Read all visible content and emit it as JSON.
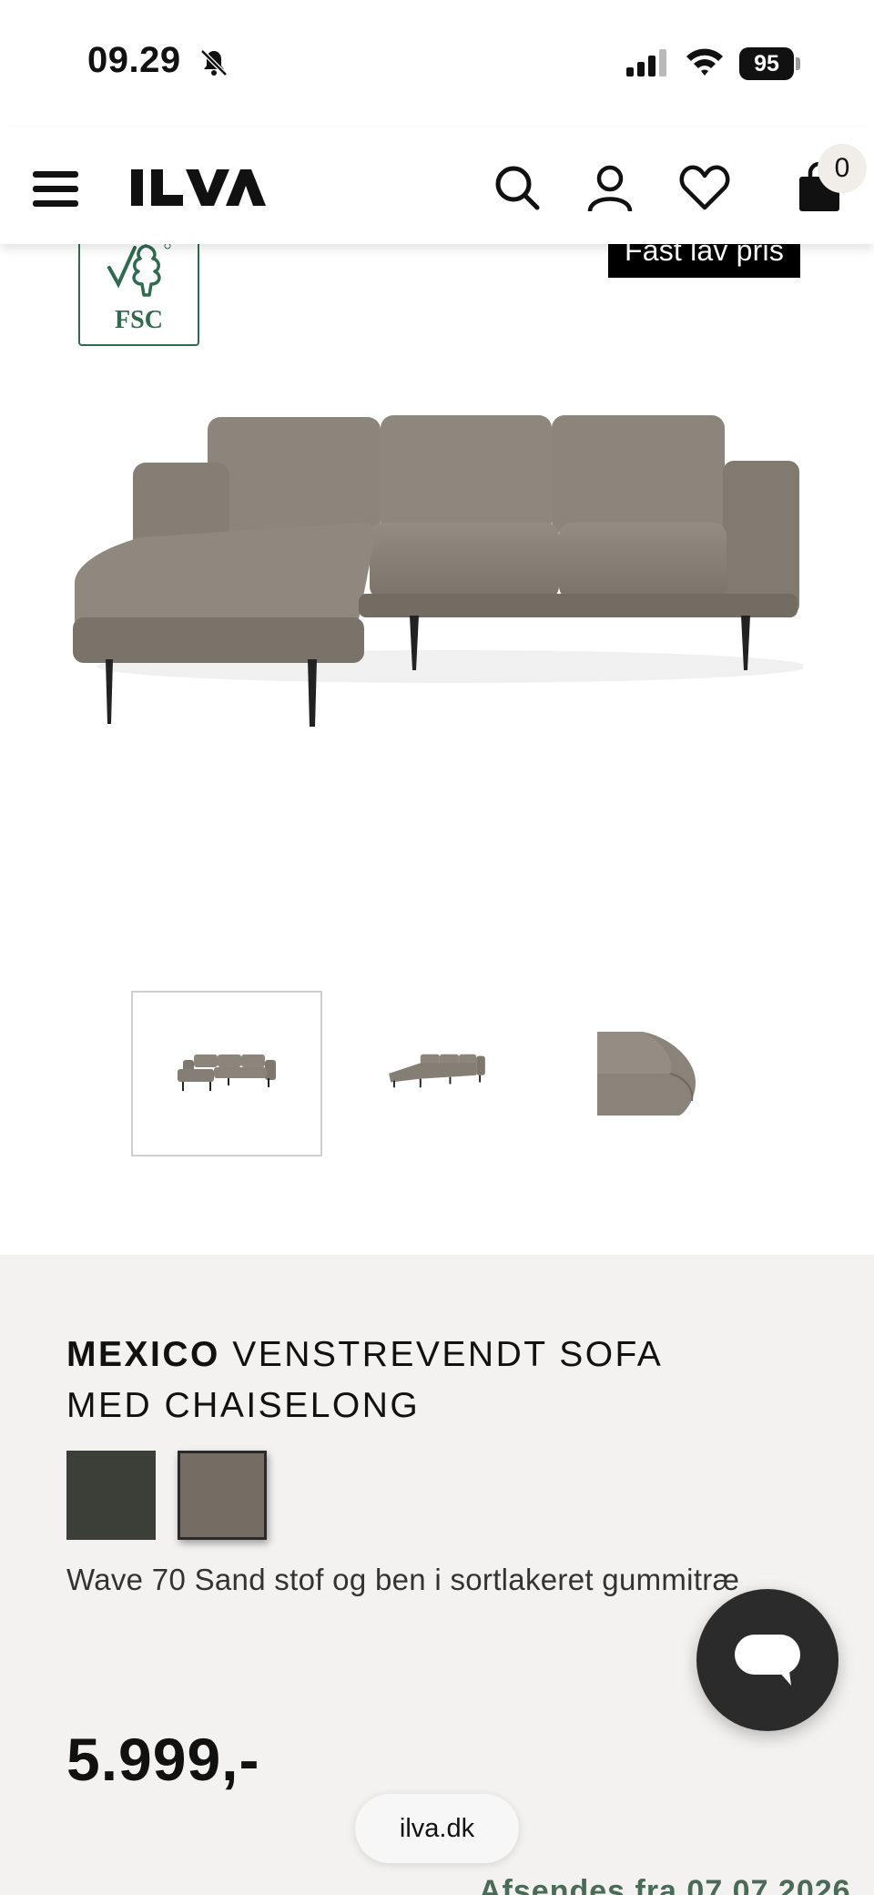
{
  "status_bar": {
    "time": "09.29",
    "battery": "95"
  },
  "header": {
    "logo_text": "ILVA",
    "cart_count": "0",
    "icons": [
      "menu-icon",
      "search-icon",
      "user-icon",
      "heart-icon",
      "bag-icon"
    ]
  },
  "gallery": {
    "badge": "Fast lav pris",
    "fsc_label": "FSC",
    "thumbnails": [
      "thumbnail-1",
      "thumbnail-2",
      "thumbnail-3"
    ],
    "active_thumbnail": 1
  },
  "product": {
    "brand": "MEXICO",
    "name": "VENSTREVENDT SOFA MED CHAISELONG",
    "swatches": [
      {
        "color": "#3b3f37"
      },
      {
        "color": "#756d63",
        "selected": true
      }
    ],
    "variant": "Wave 70 Sand stof og ben i sortlakeret gummitræ",
    "price": "5.999,-",
    "delivery": "Afsendes fra 07.07.2026"
  },
  "browser": {
    "url": "ilva.dk"
  },
  "colors": {
    "accent_green": "#4a6b57",
    "info_bg": "#f3f2f0",
    "sofa": "#8a8379"
  }
}
